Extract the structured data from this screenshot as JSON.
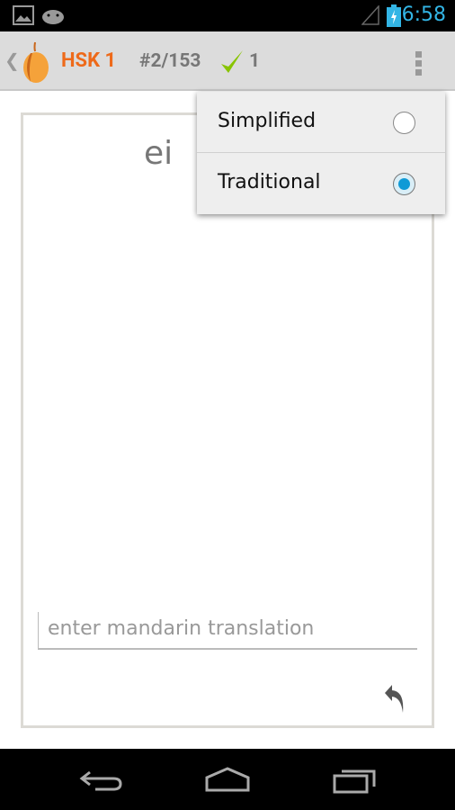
{
  "status": {
    "time": "6:58",
    "accent": "#33b5e5"
  },
  "actionbar": {
    "title": "HSK 1",
    "progress": "#2/153",
    "correct_count": "1",
    "title_color": "#ee6a1a",
    "check_color": "#88c400"
  },
  "card": {
    "word": "ei",
    "input_placeholder": "enter mandarin translation"
  },
  "menu": {
    "items": [
      {
        "label": "Simplified",
        "selected": false
      },
      {
        "label": "Traditional",
        "selected": true
      }
    ]
  }
}
